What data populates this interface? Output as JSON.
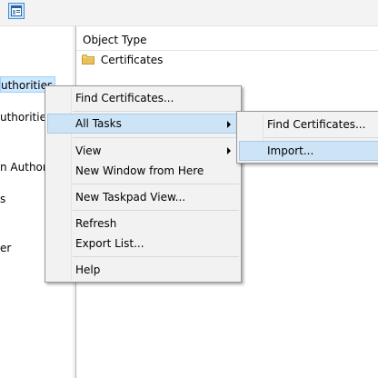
{
  "toolbar": {
    "button_icon": "properties-window-icon"
  },
  "tree": {
    "items": [
      {
        "label": "uthorities",
        "selected": true
      },
      {
        "label": "uthorities"
      },
      {
        "label": "n Author"
      },
      {
        "label": "s"
      },
      {
        "label": "er"
      }
    ]
  },
  "list": {
    "column_header": "Object Type",
    "rows": [
      {
        "label": "Certificates",
        "icon": "folder-icon"
      }
    ]
  },
  "context_menu": {
    "items": [
      {
        "label": "Find Certificates..."
      },
      {
        "label": "All Tasks",
        "has_submenu": true,
        "highlighted": true
      },
      {
        "label": "View",
        "has_submenu": true
      },
      {
        "label": "New Window from Here"
      },
      {
        "label": "New Taskpad View..."
      },
      {
        "label": "Refresh"
      },
      {
        "label": "Export List..."
      },
      {
        "label": "Help"
      }
    ]
  },
  "submenu": {
    "items": [
      {
        "label": "Find Certificates..."
      },
      {
        "label": "Import...",
        "highlighted": true
      }
    ]
  },
  "colors": {
    "highlight": "#cde4f7",
    "menu_bg": "#f2f2f2",
    "selection": "#cde8ff",
    "folder": "#e8c15a"
  }
}
